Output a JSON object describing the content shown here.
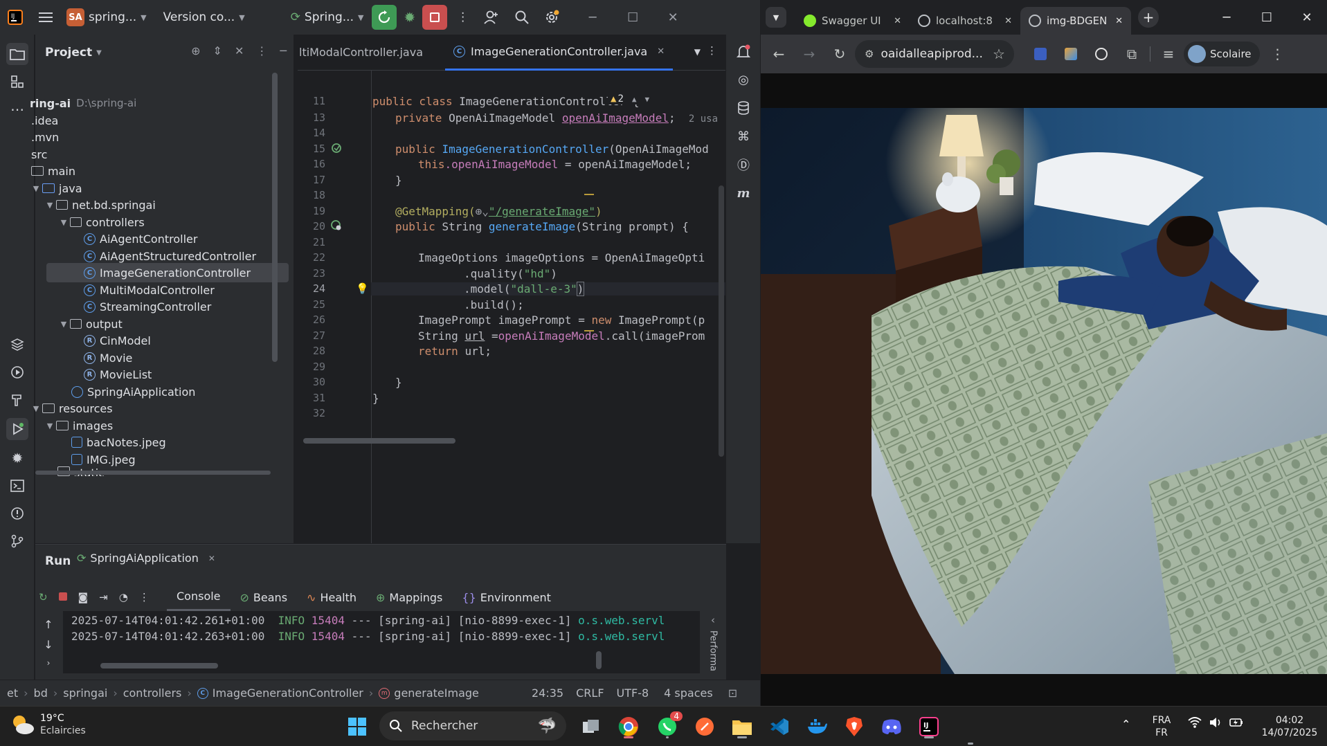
{
  "ide": {
    "project_badge": "SA",
    "project_name": "spring...",
    "vcs_label": "Version co...",
    "run_config": "Spring...",
    "project_panel_title": "Project",
    "tree": [
      {
        "label": "ring-ai",
        "hint": "D:\\spring-ai"
      },
      {
        "label": ".idea"
      },
      {
        "label": ".mvn"
      },
      {
        "label": "src"
      },
      {
        "label": "main"
      },
      {
        "label": "java"
      },
      {
        "label": "net.bd.springai"
      },
      {
        "label": "controllers"
      },
      {
        "label": "AiAgentController"
      },
      {
        "label": "AiAgentStructuredController"
      },
      {
        "label": "ImageGenerationController"
      },
      {
        "label": "MultiModalController"
      },
      {
        "label": "StreamingController"
      },
      {
        "label": "output"
      },
      {
        "label": "CinModel"
      },
      {
        "label": "Movie"
      },
      {
        "label": "MovieList"
      },
      {
        "label": "SpringAiApplication"
      },
      {
        "label": "resources"
      },
      {
        "label": "images"
      },
      {
        "label": "bacNotes.jpeg"
      },
      {
        "label": "IMG.jpeg"
      },
      {
        "label": "static"
      }
    ],
    "editor_tabs": [
      "ltiModalController.java",
      "ImageGenerationController.java"
    ],
    "warning_count": "2",
    "usages_hint": "2 usa",
    "line_numbers": [
      "11",
      "13",
      "14",
      "15",
      "16",
      "17",
      "18",
      "19",
      "20",
      "21",
      "22",
      "23",
      "24",
      "25",
      "26",
      "27",
      "28",
      "29",
      "30",
      "31",
      "32"
    ],
    "code": {
      "l11_kw": "public class ",
      "l11_name": "ImageGenerationController {",
      "l13_kw": "private ",
      "l13_type": "OpenAiImageModel ",
      "l13_field": "openAiImageModel",
      "l13_end": ";",
      "l15_kw": "public ",
      "l15_fn": "ImageGenerationController",
      "l15_rest": "(OpenAiImageMod",
      "l16_kw": "this",
      "l16_field": ".openAiImageModel",
      "l16_rest": " = openAiImageModel;",
      "l17": "}",
      "l19_ann": "@GetMapping(",
      "l19_str": "\"/generateImage\"",
      "l19_end": ")",
      "l20_kw": "public ",
      "l20_type": "String ",
      "l20_fn": "generateImage",
      "l20_rest": "(String prompt) {",
      "l22": "ImageOptions imageOptions = OpenAiImageOpti",
      "l23_pre": ".quality(",
      "l23_str": "\"hd\"",
      "l23_end": ")",
      "l24_pre": ".model(",
      "l24_str": "\"dall-e-3\"",
      "l24_end": ")",
      "l25": ".build();",
      "l26_pre": "ImagePrompt imagePrompt = ",
      "l26_kw": "new ",
      "l26_rest": "ImagePrompt(p",
      "l27_pre": "String ",
      "l27_var": "url",
      "l27_mid": " =",
      "l27_field": "openAiImageModel",
      "l27_rest": ".call(imageProm",
      "l28_kw": "return ",
      "l28_rest": "url;",
      "l30": "}",
      "l31": "}"
    },
    "run_panel": {
      "title": "Run",
      "tab": "SpringAiApplication",
      "subtabs": [
        "Console",
        "Beans",
        "Health",
        "Mappings",
        "Environment"
      ],
      "side_label": "Performa",
      "log_lines": [
        {
          "ts": "2025-07-14T04:01:42.261+01:00",
          "level": "INFO",
          "pid": "15404",
          "mid": " --- [spring-ai] [nio-8899-exec-1] ",
          "cls": "o.s.web.servl"
        },
        {
          "ts": "2025-07-14T04:01:42.263+01:00",
          "level": "INFO",
          "pid": "15404",
          "mid": " --- [spring-ai] [nio-8899-exec-1] ",
          "cls": "o.s.web.servl"
        }
      ]
    },
    "status_bar": {
      "breadcrumbs": [
        "et",
        "bd",
        "springai",
        "controllers",
        "ImageGenerationController",
        "generateImage"
      ],
      "position": "24:35",
      "line_sep": "CRLF",
      "encoding": "UTF-8",
      "indent": "4 spaces"
    }
  },
  "browser": {
    "tabs": [
      {
        "label": "Swagger UI",
        "fav_color": "#85ea2d"
      },
      {
        "label": "localhost:8",
        "fav_color": "#bdc1c6"
      },
      {
        "label": "img-BDGEN",
        "fav_color": "#bdc1c6"
      }
    ],
    "url": "oaidalleapiprod...",
    "profile_name": "Scolaire"
  },
  "taskbar": {
    "weather_temp": "19°C",
    "weather_desc": "Eclaircies",
    "search_placeholder": "Rechercher",
    "whatsapp_badge": "4",
    "lang_top": "FRA",
    "lang_bottom": "FR",
    "time": "04:02",
    "date": "14/07/2025"
  },
  "colors": {
    "ide_bg": "#1e1f22",
    "ide_panel": "#2b2d30",
    "accent": "#3574f0",
    "run_green": "#3e9a55",
    "stop_red": "#c94f4f"
  }
}
